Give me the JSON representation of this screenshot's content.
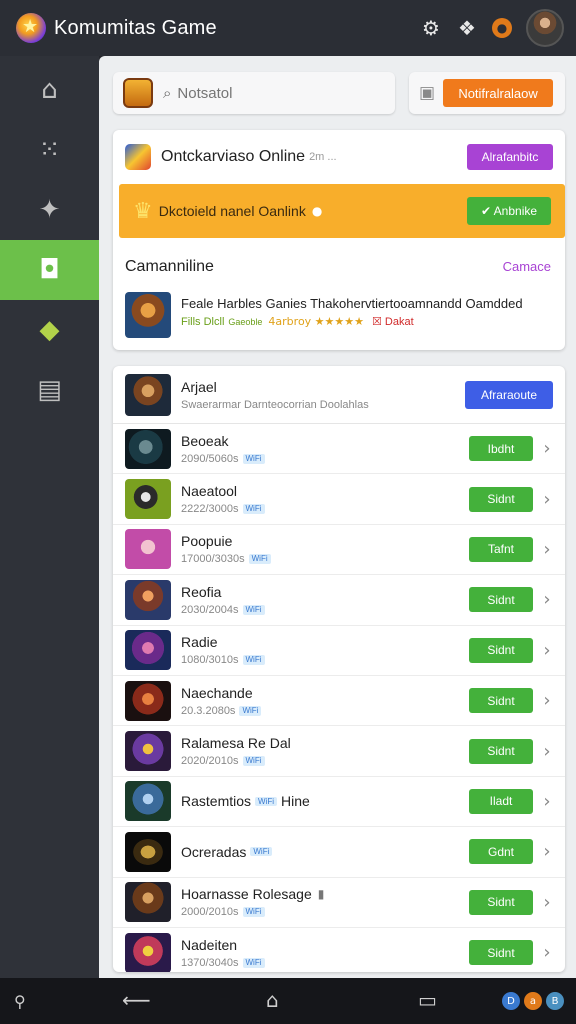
{
  "header": {
    "title": "Komumitas Game",
    "icons": [
      "app-logo-icon",
      "gear-icon",
      "cards-icon",
      "notification-icon",
      "avatar"
    ]
  },
  "sidebar": {
    "items": [
      {
        "name": "home",
        "icon": "⌂",
        "active": false
      },
      {
        "name": "apps",
        "icon": "⁙",
        "active": false
      },
      {
        "name": "pin",
        "icon": "✦",
        "active": false
      },
      {
        "name": "community",
        "icon": "◘",
        "active": true
      },
      {
        "name": "game",
        "icon": "◆",
        "active": false
      },
      {
        "name": "storage",
        "icon": "▤",
        "active": false
      }
    ]
  },
  "search": {
    "placeholder": "Notsatol",
    "notification_button": "Notifralralaow"
  },
  "featured": {
    "title": "Ontckarviaso Online",
    "subtitle": "2m ...",
    "button": "Alrafanbitc",
    "banner_text": "Dkctoield nanel Oanlink",
    "banner_button": "Anbnike",
    "section_title": "Camanniline",
    "section_link": "Camace",
    "item_title": "Feale Harbles Ganies Thakohervtiertooamnandd Oamdded",
    "item_meta": "Fills Dlcll",
    "item_note": "Gaeoble",
    "item_rating_text": "4arbroy ★★★★★",
    "item_badge": "Dakat"
  },
  "list": {
    "header": {
      "name": "Arjael",
      "meta": "Swaerarmar Darnteocorrian Doolahlas",
      "button": "Afraraoute"
    },
    "rows": [
      {
        "name": "Beoeak",
        "meta": "2090/5060s",
        "tag": "WiFi",
        "button": "Ibdht",
        "thumb": "t2"
      },
      {
        "name": "Naeatool",
        "meta": "2222/3000s",
        "tag": "WiFi",
        "button": "Sidnt",
        "thumb": "t3"
      },
      {
        "name": "Poopuie",
        "meta": "17000/3030s",
        "tag": "WiFi",
        "button": "Tafnt",
        "thumb": "t4"
      },
      {
        "name": "Reofia",
        "meta": "2030/2004s",
        "tag": "WiFi",
        "button": "Sidnt",
        "thumb": "t5"
      },
      {
        "name": "Radie",
        "meta": "1080/3010s",
        "tag": "WiFi",
        "button": "Sidnt",
        "thumb": "t6"
      },
      {
        "name": "Naechande",
        "meta": "20.3.2080s",
        "tag": "WiFi",
        "button": "Sidnt",
        "thumb": "t7"
      },
      {
        "name": "Ralamesa Re Dal",
        "meta": "2020/2010s",
        "tag": "WiFi",
        "button": "Sidnt",
        "thumb": "t8"
      },
      {
        "name": "Rastemtios",
        "meta": "",
        "tag": "WiFi",
        "name_suffix": "Hine",
        "button": "Iladt",
        "thumb": "t9"
      },
      {
        "name": "Ocreradas",
        "meta": "",
        "tag": "WiFi",
        "button": "Gdnt",
        "thumb": "t10"
      },
      {
        "name": "Hoarnasse Rolesage",
        "meta": "2000/2010s",
        "tag": "WiFi",
        "button": "Sidnt",
        "thumb": "t11",
        "lock": true
      },
      {
        "name": "Nadeiten",
        "meta": "1370/3040s",
        "tag": "WiFi",
        "button": "Sidnt",
        "thumb": "t12"
      }
    ]
  },
  "bottombar": {
    "nav": [
      "location-icon",
      "back-icon",
      "home-icon",
      "recents-icon"
    ],
    "status": [
      "D",
      "a",
      "B"
    ]
  },
  "colors": {
    "accent_green": "#6cc04a",
    "button_green": "#44b13b",
    "button_orange": "#f07a1c",
    "button_purple": "#a843d4",
    "button_blue": "#3e5ee6",
    "banner_yellow": "#f8ae2b"
  }
}
